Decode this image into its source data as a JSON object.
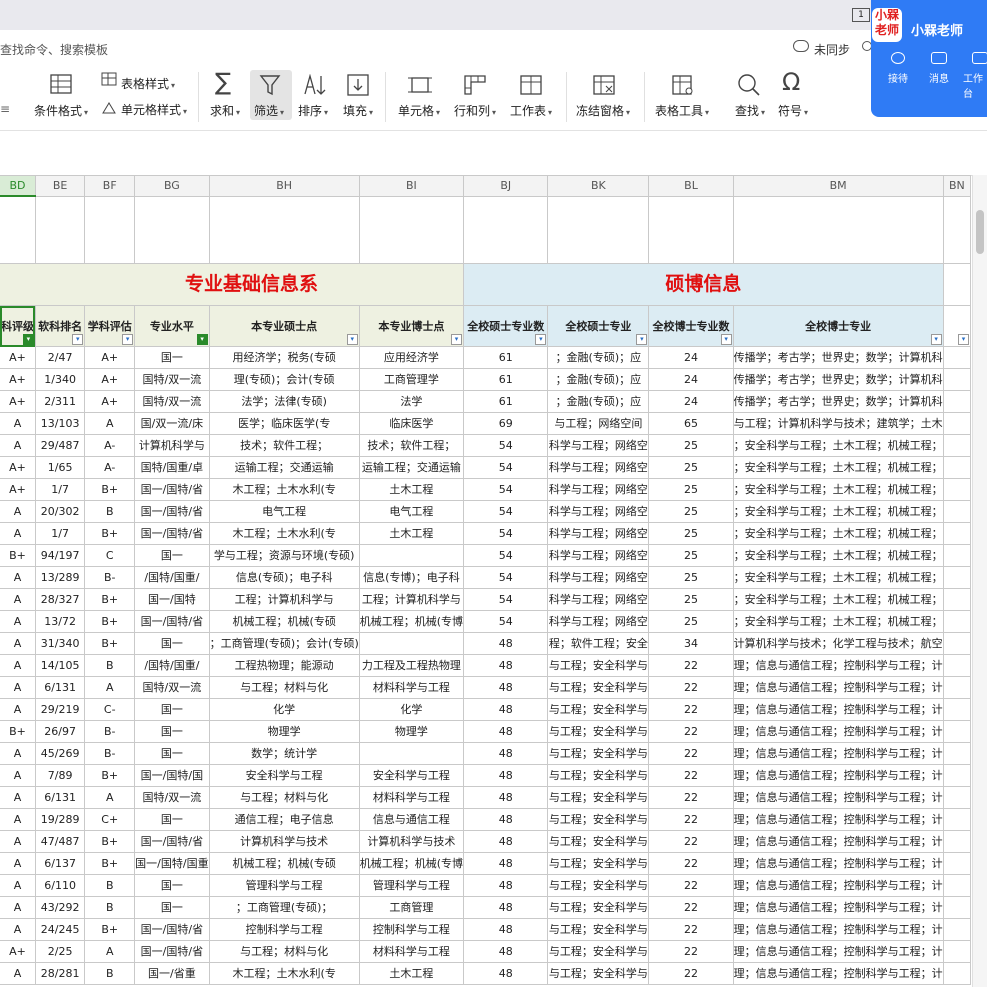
{
  "topbar": {
    "search_hint": "查找命令、搜索模板",
    "sync_label": "未同步",
    "page_badge": "1"
  },
  "ribbon": {
    "table_style": "表格样式",
    "cond_format": "条件格式",
    "cell_style": "单元格样式",
    "sum": "求和",
    "filter": "筛选",
    "sort": "排序",
    "fill": "填充",
    "cell": "单元格",
    "rowcol": "行和列",
    "worksheet": "工作表",
    "freeze": "冻结窗格",
    "table_tools": "表格工具",
    "find": "查找",
    "symbol": "符号"
  },
  "user": {
    "avatar_text": "小槑老师",
    "name": "小槑老师",
    "receive": "接待",
    "message": "消息",
    "work": "工作台"
  },
  "sheet": {
    "columns": [
      "BD",
      "BE",
      "BF",
      "BG",
      "BH",
      "BI",
      "BJ",
      "BK",
      "BL",
      "BM",
      "BN"
    ],
    "group_basic": "专业基础信息系",
    "group_master_phd": "硕博信息",
    "headers": [
      "科评级",
      "软科排名",
      "学科评估",
      "专业水平",
      "本专业硕士点",
      "本专业博士点",
      "全校硕士专业数",
      "全校硕士专业",
      "全校博士专业数",
      "全校博士专业",
      ""
    ],
    "rows": [
      [
        "A+",
        "2/47",
        "A+",
        "国一",
        "用经济学；税务(专硕",
        "应用经济学",
        "61",
        "；金融(专硕)；应",
        "24",
        "传播学；考古学；世界史；数学；计算机科"
      ],
      [
        "A+",
        "1/340",
        "A+",
        "国特/双一流",
        "理(专硕)；会计(专硕",
        "工商管理学",
        "61",
        "；金融(专硕)；应",
        "24",
        "传播学；考古学；世界史；数学；计算机科"
      ],
      [
        "A+",
        "2/311",
        "A+",
        "国特/双一流",
        "法学；法律(专硕)",
        "法学",
        "61",
        "；金融(专硕)；应",
        "24",
        "传播学；考古学；世界史；数学；计算机科"
      ],
      [
        "A",
        "13/103",
        "A",
        "国/双一流/床",
        "医学；临床医学(专",
        "临床医学",
        "69",
        "与工程；网络空间",
        "65",
        "与工程；计算机科学与技术；建筑学；土木"
      ],
      [
        "A",
        "29/487",
        "A-",
        "计算机科学与",
        "技术；软件工程；",
        "技术；软件工程；",
        "54",
        "科学与工程；网络空",
        "25",
        "；安全科学与工程；土木工程；机械工程；"
      ],
      [
        "A+",
        "1/65",
        "A-",
        "国特/国重/卓",
        "运输工程；交通运输",
        "运输工程；交通运输",
        "54",
        "科学与工程；网络空",
        "25",
        "；安全科学与工程；土木工程；机械工程；"
      ],
      [
        "A+",
        "1/7",
        "B+",
        "国一/国特/省",
        "木工程；土木水利(专",
        "土木工程",
        "54",
        "科学与工程；网络空",
        "25",
        "；安全科学与工程；土木工程；机械工程；"
      ],
      [
        "A",
        "20/302",
        "B",
        "国一/国特/省",
        "电气工程",
        "电气工程",
        "54",
        "科学与工程；网络空",
        "25",
        "；安全科学与工程；土木工程；机械工程；"
      ],
      [
        "A",
        "1/7",
        "B+",
        "国一/国特/省",
        "木工程；土木水利(专",
        "土木工程",
        "54",
        "科学与工程；网络空",
        "25",
        "；安全科学与工程；土木工程；机械工程；"
      ],
      [
        "B+",
        "94/197",
        "C",
        "国一",
        "学与工程；资源与环境(专硕)",
        "",
        "54",
        "科学与工程；网络空",
        "25",
        "；安全科学与工程；土木工程；机械工程；"
      ],
      [
        "A",
        "13/289",
        "B-",
        "/国特/国重/",
        "信息(专硕)；电子科",
        "信息(专博)；电子科",
        "54",
        "科学与工程；网络空",
        "25",
        "；安全科学与工程；土木工程；机械工程；"
      ],
      [
        "A",
        "28/327",
        "B+",
        "国一/国特",
        "工程；计算机科学与",
        "工程；计算机科学与",
        "54",
        "科学与工程；网络空",
        "25",
        "；安全科学与工程；土木工程；机械工程；"
      ],
      [
        "A",
        "13/72",
        "B+",
        "国一/国特/省",
        "机械工程；机械(专硕",
        "机械工程；机械(专博",
        "54",
        "科学与工程；网络空",
        "25",
        "；安全科学与工程；土木工程；机械工程；"
      ],
      [
        "A",
        "31/340",
        "B+",
        "国一",
        "；工商管理(专硕)；会计(专硕)",
        "",
        "48",
        "程；软件工程；安全",
        "34",
        "计算机科学与技术；化学工程与技术；航空"
      ],
      [
        "A",
        "14/105",
        "B",
        "/国特/国重/",
        "工程热物理；能源动",
        "力工程及工程热物理",
        "48",
        "与工程；安全科学与",
        "22",
        "理；信息与通信工程；控制科学与工程；计"
      ],
      [
        "A",
        "6/131",
        "A",
        "国特/双一流",
        "与工程；材料与化",
        "材料科学与工程",
        "48",
        "与工程；安全科学与",
        "22",
        "理；信息与通信工程；控制科学与工程；计"
      ],
      [
        "A",
        "29/219",
        "C-",
        "国一",
        "化学",
        "化学",
        "48",
        "与工程；安全科学与",
        "22",
        "理；信息与通信工程；控制科学与工程；计"
      ],
      [
        "B+",
        "26/97",
        "B-",
        "国一",
        "物理学",
        "物理学",
        "48",
        "与工程；安全科学与",
        "22",
        "理；信息与通信工程；控制科学与工程；计"
      ],
      [
        "A",
        "45/269",
        "B-",
        "国一",
        "数学；统计学",
        "",
        "48",
        "与工程；安全科学与",
        "22",
        "理；信息与通信工程；控制科学与工程；计"
      ],
      [
        "A",
        "7/89",
        "B+",
        "国一/国特/国",
        "安全科学与工程",
        "安全科学与工程",
        "48",
        "与工程；安全科学与",
        "22",
        "理；信息与通信工程；控制科学与工程；计"
      ],
      [
        "A",
        "6/131",
        "A",
        "国特/双一流",
        "与工程；材料与化",
        "材料科学与工程",
        "48",
        "与工程；安全科学与",
        "22",
        "理；信息与通信工程；控制科学与工程；计"
      ],
      [
        "A",
        "19/289",
        "C+",
        "国一",
        "通信工程；电子信息",
        "信息与通信工程",
        "48",
        "与工程；安全科学与",
        "22",
        "理；信息与通信工程；控制科学与工程；计"
      ],
      [
        "A",
        "47/487",
        "B+",
        "国一/国特/省",
        "计算机科学与技术",
        "计算机科学与技术",
        "48",
        "与工程；安全科学与",
        "22",
        "理；信息与通信工程；控制科学与工程；计"
      ],
      [
        "A",
        "6/137",
        "B+",
        "国一/国特/国重",
        "机械工程；机械(专硕",
        "机械工程；机械(专博",
        "48",
        "与工程；安全科学与",
        "22",
        "理；信息与通信工程；控制科学与工程；计"
      ],
      [
        "A",
        "6/110",
        "B",
        "国一",
        "管理科学与工程",
        "管理科学与工程",
        "48",
        "与工程；安全科学与",
        "22",
        "理；信息与通信工程；控制科学与工程；计"
      ],
      [
        "A",
        "43/292",
        "B",
        "国一",
        "；工商管理(专硕)；",
        "工商管理",
        "48",
        "与工程；安全科学与",
        "22",
        "理；信息与通信工程；控制科学与工程；计"
      ],
      [
        "A",
        "24/245",
        "B+",
        "国一/国特/省",
        "控制科学与工程",
        "控制科学与工程",
        "48",
        "与工程；安全科学与",
        "22",
        "理；信息与通信工程；控制科学与工程；计"
      ],
      [
        "A+",
        "2/25",
        "A",
        "国一/国特/省",
        "与工程；材料与化",
        "材料科学与工程",
        "48",
        "与工程；安全科学与",
        "22",
        "理；信息与通信工程；控制科学与工程；计"
      ],
      [
        "A",
        "28/281",
        "B",
        "国一/省重",
        "木工程；土木水利(专",
        "土木工程",
        "48",
        "与工程；安全科学与",
        "22",
        "理；信息与通信工程；控制科学与工程；计"
      ]
    ]
  }
}
